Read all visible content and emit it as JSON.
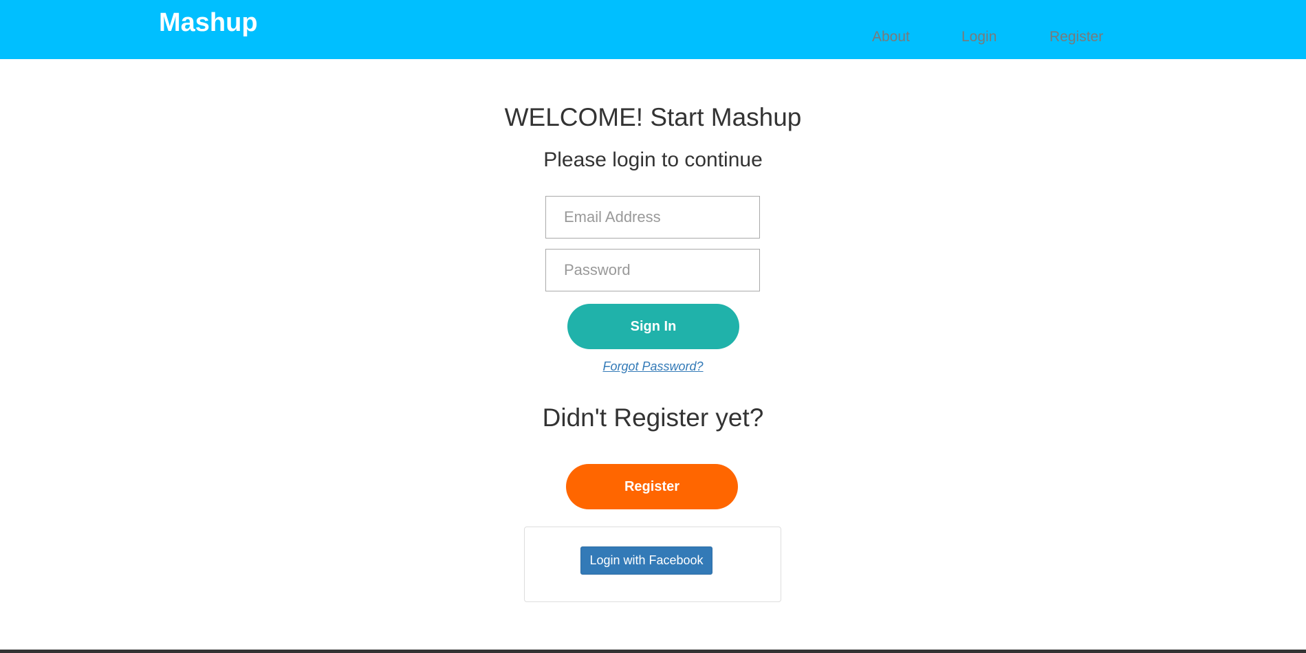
{
  "navbar": {
    "brand": "Mashup",
    "links": [
      {
        "label": "About"
      },
      {
        "label": "Login"
      },
      {
        "label": "Register"
      }
    ]
  },
  "login": {
    "welcome": "WELCOME! Start Mashup",
    "subtitle": "Please login to continue",
    "email_placeholder": "Email Address",
    "password_placeholder": "Password",
    "signin_label": "Sign In",
    "forgot_label": "Forgot Password?"
  },
  "register": {
    "prompt": "Didn't Register yet?",
    "button_label": "Register"
  },
  "facebook": {
    "button_label": "Login with Facebook"
  },
  "colors": {
    "navbar_bg": "#00bfff",
    "signin_bg": "#20b2aa",
    "register_bg": "#ff6600",
    "facebook_bg": "#337ab7",
    "link": "#337ab7"
  }
}
